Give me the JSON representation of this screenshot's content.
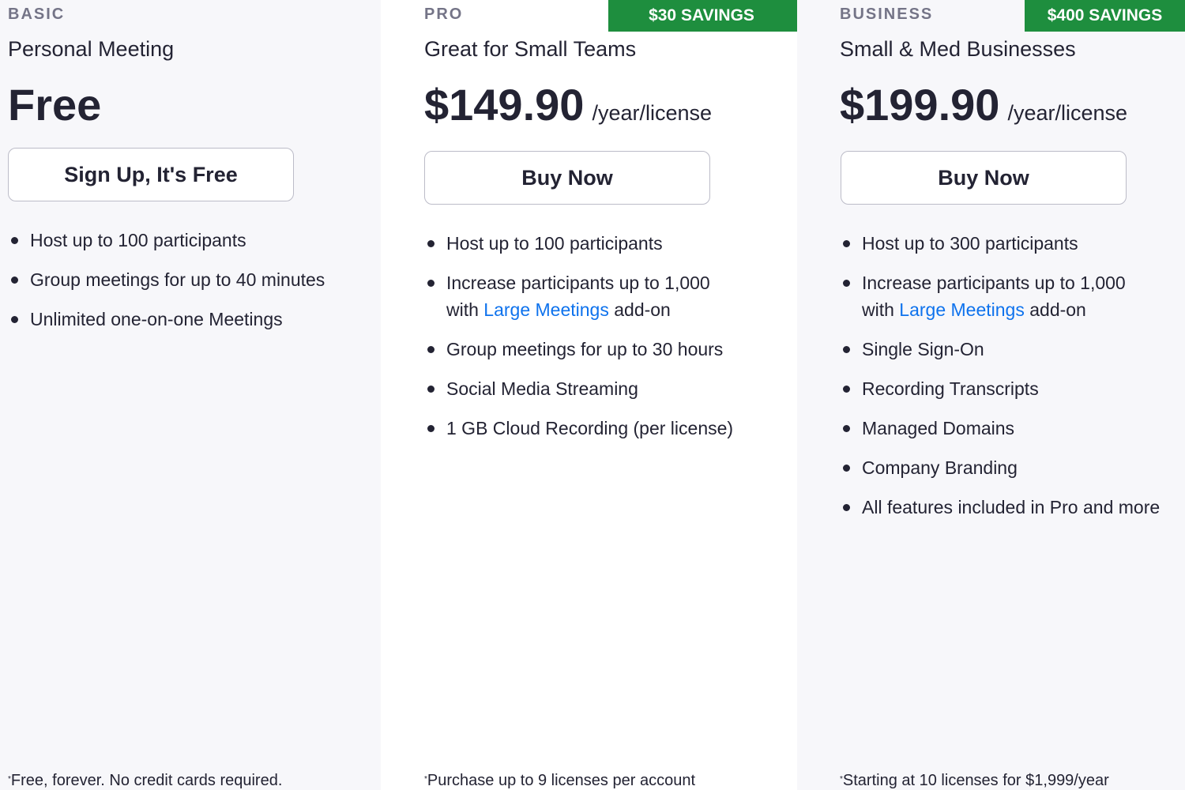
{
  "colors": {
    "link": "#0e72ed",
    "badge": "#1e8e3e",
    "text": "#232333",
    "tier": "#747487"
  },
  "basic": {
    "tier": "BASIC",
    "subtitle": "Personal Meeting",
    "price": "Free",
    "button": "Sign Up, It's Free",
    "features": [
      "Host up to 100 participants",
      "Group meetings for up to 40 minutes",
      "Unlimited one-on-one Meetings"
    ],
    "footnote_mark": "*",
    "footnote": "Free, forever. No credit cards required."
  },
  "pro": {
    "tier": "PRO",
    "badge": "$30 SAVINGS",
    "subtitle": "Great for Small Teams",
    "price": "$149.90",
    "per": "/year/license",
    "button": "Buy Now",
    "features": [
      "Host up to 100 participants",
      {
        "line1": "Increase participants up to 1,000",
        "pre": "with ",
        "link": "Large Meetings",
        "post": " add-on"
      },
      "Group meetings for up to 30 hours",
      "Social Media Streaming",
      "1 GB Cloud Recording (per license)"
    ],
    "footnote_mark": "*",
    "footnote": "Purchase up to 9 licenses per account"
  },
  "business": {
    "tier": "BUSINESS",
    "badge": "$400 SAVINGS",
    "subtitle": "Small & Med Businesses",
    "price": "$199.90",
    "per": "/year/license",
    "button": "Buy Now",
    "features": [
      "Host up to 300 participants",
      {
        "line1": "Increase participants up to 1,000",
        "pre": "with ",
        "link": "Large Meetings",
        "post": " add-on"
      },
      "Single Sign-On",
      "Recording Transcripts",
      "Managed Domains",
      "Company Branding",
      "All features included in Pro and more"
    ],
    "footnote_mark": "*",
    "footnote": "Starting at 10 licenses for $1,999/year"
  }
}
